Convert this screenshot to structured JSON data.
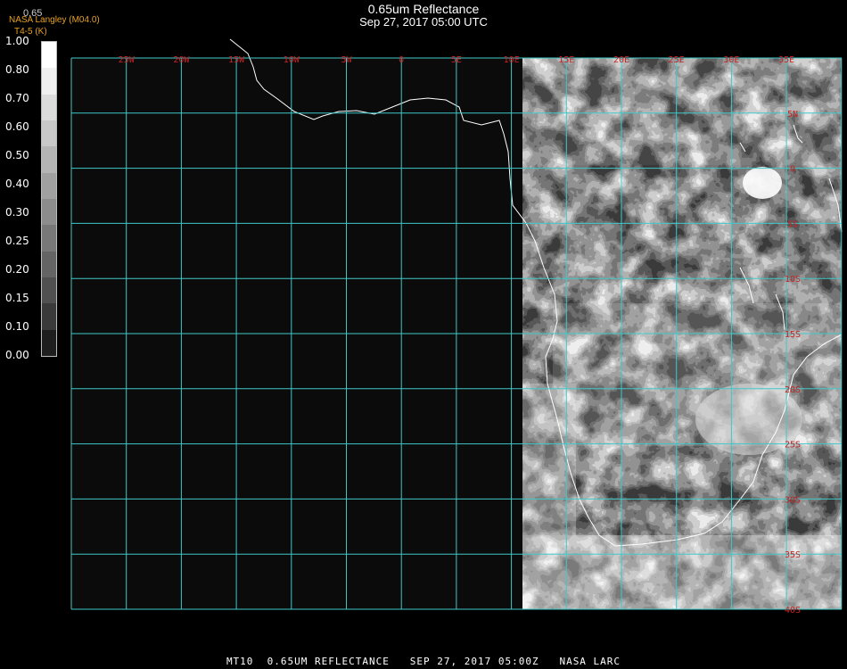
{
  "header": {
    "title": "0.65um Reflectance",
    "datetime": "Sep 27, 2017 05:00 UTC",
    "credit": "NASA Langley (M04.0)",
    "credit_line2": "T4-5 (K)",
    "band_label": "0.65"
  },
  "colorbar": {
    "labels": [
      "1.00",
      "0.80",
      "0.70",
      "0.60",
      "0.50",
      "0.40",
      "0.30",
      "0.25",
      "0.20",
      "0.15",
      "0.10",
      "0.00"
    ],
    "colors": [
      "#ffffff",
      "#f0f0f0",
      "#dcdcdc",
      "#c8c8c8",
      "#b4b4b4",
      "#a0a0a0",
      "#8c8c8c",
      "#787878",
      "#646464",
      "#505050",
      "#3a3a3a",
      "#1e1e1e"
    ]
  },
  "grid": {
    "lon_labels": [
      "25W",
      "20W",
      "15W",
      "10W",
      "5W",
      "0",
      "5E",
      "10E",
      "15E",
      "20E",
      "25E",
      "30E",
      "35E"
    ],
    "lat_labels": [
      "5N",
      "0",
      "5S",
      "10S",
      "15S",
      "20S",
      "25S",
      "30S",
      "35S",
      "40S"
    ],
    "grid_color": "#40c8c8",
    "label_color": "#cc2222"
  },
  "footer": {
    "text": "MT10  0.65UM REFLECTANCE   SEP 27, 2017 05:00Z   NASA LARC"
  }
}
